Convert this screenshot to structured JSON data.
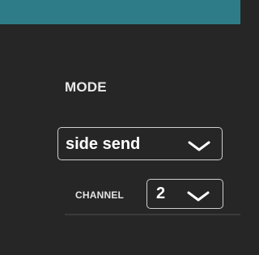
{
  "colors": {
    "top_bar": "#2e7c88",
    "background": "#262626",
    "text": "#ffffff",
    "border": "#cfcfcf"
  },
  "mode": {
    "label": "MODE",
    "selected": "side send",
    "icon": "chevron-down-icon"
  },
  "channel": {
    "label": "CHANNEL",
    "selected": "2",
    "icon": "chevron-down-icon"
  }
}
